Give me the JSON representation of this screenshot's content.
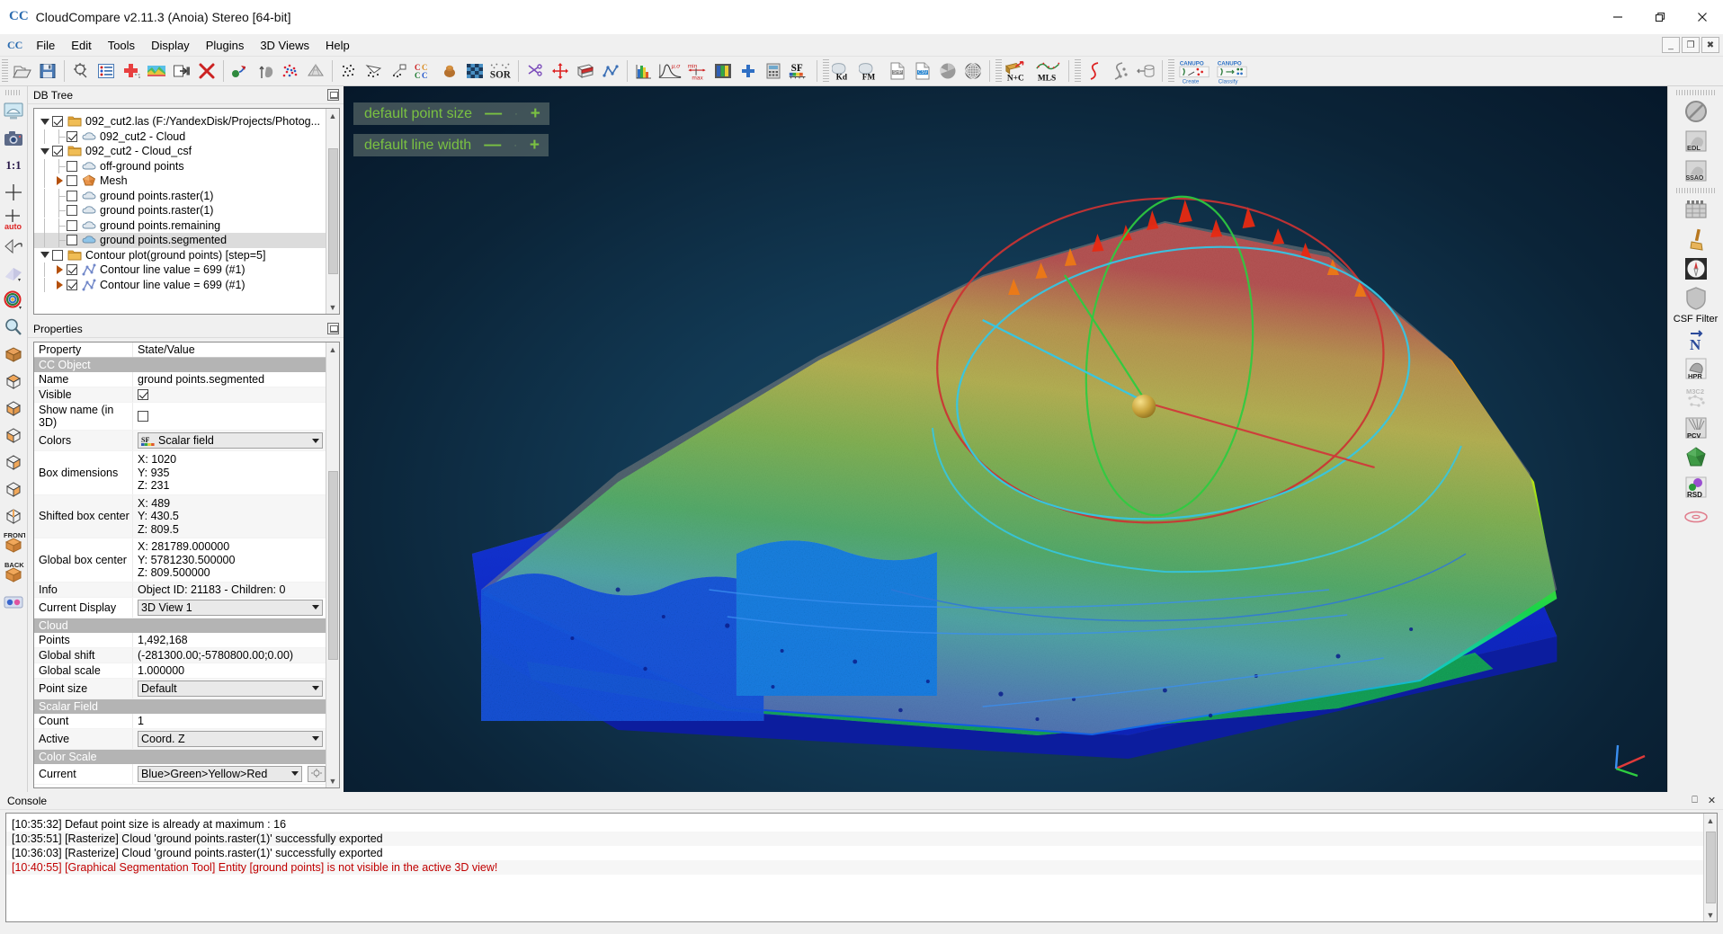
{
  "window": {
    "title": "CloudCompare v2.11.3 (Anoia) Stereo [64-bit]",
    "logo": "CC",
    "minimize": "minimize-icon",
    "maximize": "maximize-icon",
    "close": "close-icon",
    "mdi_restore": "_",
    "mdi_tile": "❐",
    "mdi_close": "✖"
  },
  "menubar": {
    "items": [
      {
        "label": "File"
      },
      {
        "label": "Edit"
      },
      {
        "label": "Tools"
      },
      {
        "label": "Display"
      },
      {
        "label": "Plugins"
      },
      {
        "label": "3D Views"
      },
      {
        "label": "Help"
      }
    ]
  },
  "toolbar": {
    "groups": [
      {
        "buttons": [
          {
            "name": "open-file-icon",
            "tip": "Open"
          },
          {
            "name": "save-file-icon",
            "tip": "Save"
          }
        ]
      },
      {
        "buttons": [
          {
            "name": "global-shift-settings-icon",
            "tip": "Global shift settings"
          },
          {
            "name": "display-properties-icon",
            "tip": "Display settings"
          },
          {
            "name": "add-point-icon",
            "tip": "Add point"
          },
          {
            "name": "colors-icon",
            "tip": "Colors"
          },
          {
            "name": "clone-icon",
            "tip": "Clone"
          },
          {
            "name": "delete-icon",
            "tip": "Delete"
          }
        ]
      },
      {
        "buttons": [
          {
            "name": "merge-icon",
            "tip": "Merge"
          },
          {
            "name": "normals-icon",
            "tip": "Compute normals"
          },
          {
            "name": "subsample-icon",
            "tip": "Subsample"
          },
          {
            "name": "mesh-icon",
            "tip": "Mesh"
          }
        ]
      },
      {
        "buttons": [
          {
            "name": "cloud-cloud-dist-icon",
            "tip": "Cloud/cloud distance"
          },
          {
            "name": "cloud-mesh-dist-icon",
            "tip": "Cloud/mesh distance"
          },
          {
            "name": "cloud-primitive-dist-icon",
            "tip": "Cloud/primitive distance"
          },
          {
            "name": "cc-registration-icon",
            "tip": "Register"
          },
          {
            "name": "match-bb-icon",
            "tip": "Match bounding boxes"
          },
          {
            "name": "statistical-test-icon",
            "tip": "Statistical test"
          },
          {
            "name": "sor-filter-icon",
            "tip": "SOR filter"
          }
        ]
      },
      {
        "buttons": [
          {
            "name": "segment-icon",
            "tip": "Segment"
          },
          {
            "name": "translate-rotate-icon",
            "tip": "Translate/Rotate"
          },
          {
            "name": "cross-section-icon",
            "tip": "Cross section"
          },
          {
            "name": "polyline-icon",
            "tip": "Trace polyline"
          }
        ]
      },
      {
        "buttons": [
          {
            "name": "histogram-icon",
            "tip": "Histogram"
          },
          {
            "name": "gaussian-filter-icon",
            "tip": "Gaussian filter"
          },
          {
            "name": "min-max-icon",
            "tip": "Min/max"
          },
          {
            "name": "color-scale-icon",
            "tip": "Color scale"
          },
          {
            "name": "add-sf-icon",
            "tip": "Add scalar field"
          },
          {
            "name": "sf-calculator-icon",
            "tip": "SF arithmetics"
          },
          {
            "name": "sf-display-icon",
            "tip": "SF display params"
          }
        ]
      },
      {
        "buttons": [
          {
            "name": "kd-tree-icon",
            "tip": "Kd-tree"
          },
          {
            "name": "fast-marching-icon",
            "tip": "Fast marching"
          },
          {
            "name": "shp-export-icon",
            "tip": "Export SHP"
          },
          {
            "name": "csv-export-icon",
            "tip": "Export CSV"
          },
          {
            "name": "fit-plane-icon",
            "tip": "Fit plane"
          },
          {
            "name": "fit-sphere-icon",
            "tip": "Fit sphere"
          }
        ]
      },
      {
        "buttons": [
          {
            "name": "normals-and-curvature-icon",
            "tip": "N+C"
          },
          {
            "name": "mls-smoothing-icon",
            "tip": "MLS"
          }
        ]
      },
      {
        "buttons": [
          {
            "name": "spline-icon",
            "tip": "Spline"
          },
          {
            "name": "section-extract-icon",
            "tip": "Extract sections"
          },
          {
            "name": "unroll-icon",
            "tip": "Unroll"
          }
        ]
      },
      {
        "buttons": [
          {
            "name": "canupo-create-icon",
            "tip": "CANUPO Create"
          },
          {
            "name": "canupo-classify-icon",
            "tip": "CANUPO Classify"
          }
        ]
      }
    ],
    "canupo_create_label": "Create",
    "canupo_classify_label": "Classify",
    "ncs_label": "N+C",
    "mls_label": "MLS",
    "kd_label": "Kd",
    "fm_label": "FM",
    "sor_label": "SOR",
    "sf_label": "SF",
    "canupo_label": "CANUPO"
  },
  "left_toolbar": {
    "buttons": [
      {
        "name": "set-view-to-screen-icon"
      },
      {
        "name": "snapshot-icon"
      },
      {
        "name": "zoom-one-to-one-icon",
        "label": "1:1"
      },
      {
        "name": "pick-rotation-center-icon"
      },
      {
        "name": "auto-pick-rotation-center-icon",
        "label": "auto"
      },
      {
        "name": "toggle-camera-projection-icon"
      },
      {
        "name": "light-settings-icon"
      },
      {
        "name": "color-ramp-icon"
      },
      {
        "name": "zoom-global-icon"
      },
      {
        "name": "bounding-box-icon"
      },
      {
        "name": "view-top-icon"
      },
      {
        "name": "view-bottom-icon"
      },
      {
        "name": "view-left-icon"
      },
      {
        "name": "view-right-icon"
      },
      {
        "name": "view-back-icon"
      },
      {
        "name": "view-iso1-icon"
      },
      {
        "name": "view-front-icon",
        "label": "FRONT"
      },
      {
        "name": "view-rear-icon",
        "label": "BACK"
      },
      {
        "name": "stereo-mode-icon"
      }
    ]
  },
  "right_toolbar": {
    "groups": [
      {
        "buttons": [
          {
            "name": "no-shader-icon",
            "label": ""
          },
          {
            "name": "edl-shader-icon",
            "label": "EDL"
          },
          {
            "name": "ssao-shader-icon",
            "label": "SSAO"
          }
        ]
      },
      {
        "buttons": [
          {
            "name": "animation-plugin-icon",
            "label": ""
          },
          {
            "name": "broom-plugin-icon",
            "label": ""
          },
          {
            "name": "compass-plugin-icon",
            "label": ""
          },
          {
            "name": "csf-filter-plugin-icon",
            "label": "CSF Filter"
          },
          {
            "name": "north-arrow-plugin-icon",
            "label": "N"
          },
          {
            "name": "hpr-plugin-icon",
            "label": "HPR"
          },
          {
            "name": "m3c2-plugin-icon",
            "label": "M3C2"
          },
          {
            "name": "pcv-plugin-icon",
            "label": "PCV"
          },
          {
            "name": "poisson-recon-plugin-icon",
            "label": ""
          },
          {
            "name": "rgb-plugin-icon",
            "label": "RSD"
          },
          {
            "name": "torus-plugin-icon",
            "label": ""
          }
        ]
      }
    ],
    "csf_filter_label": "CSF Filter"
  },
  "db_tree": {
    "title": "DB Tree",
    "items": [
      {
        "indent": 0,
        "expander": "down",
        "checked": true,
        "icon": "folder-icon",
        "label": "092_cut2.las (F:/YandexDisk/Projects/Photog...",
        "selected": false
      },
      {
        "indent": 1,
        "expander": "none",
        "checked": true,
        "icon": "cloud-icon",
        "label": "092_cut2 - Cloud",
        "selected": false
      },
      {
        "indent": 0,
        "expander": "down",
        "checked": true,
        "icon": "folder-icon",
        "label": "092_cut2 - Cloud_csf",
        "selected": false
      },
      {
        "indent": 1,
        "expander": "none",
        "checked": false,
        "icon": "cloud-icon",
        "label": "off-ground points",
        "selected": false
      },
      {
        "indent": 1,
        "expander": "right",
        "checked": false,
        "icon": "mesh-icon",
        "label": "Mesh",
        "selected": false
      },
      {
        "indent": 1,
        "expander": "none",
        "checked": false,
        "icon": "cloud-icon",
        "label": "ground points.raster(1)",
        "selected": false
      },
      {
        "indent": 1,
        "expander": "none",
        "checked": false,
        "icon": "cloud-icon",
        "label": "ground points.raster(1)",
        "selected": false
      },
      {
        "indent": 1,
        "expander": "none",
        "checked": false,
        "icon": "cloud-icon",
        "label": "ground points.remaining",
        "selected": false
      },
      {
        "indent": 1,
        "expander": "none",
        "checked": false,
        "icon": "cloud-icon",
        "label": "ground points.segmented",
        "selected": true
      },
      {
        "indent": 0,
        "expander": "down",
        "checked": false,
        "icon": "folder-icon",
        "label": "Contour plot(ground points) [step=5]",
        "selected": false
      },
      {
        "indent": 1,
        "expander": "right",
        "checked": true,
        "icon": "polyline-icon",
        "label": "Contour line value = 699 (#1)",
        "selected": false
      },
      {
        "indent": 1,
        "expander": "right",
        "checked": true,
        "icon": "polyline-icon",
        "label": "Contour line value = 699 (#1)",
        "selected": false
      }
    ]
  },
  "properties": {
    "title": "Properties",
    "header": {
      "key": "Property",
      "value": "State/Value"
    },
    "rows": [
      {
        "type": "section",
        "label": "CC Object"
      },
      {
        "type": "text",
        "key": "Name",
        "value": "ground points.segmented"
      },
      {
        "type": "check",
        "key": "Visible",
        "checked": true
      },
      {
        "type": "check",
        "key": "Show name (in 3D)",
        "checked": false
      },
      {
        "type": "combo-sf",
        "key": "Colors",
        "value": "Scalar field"
      },
      {
        "type": "multi",
        "key": "Box dimensions",
        "lines": [
          "X: 1020",
          "Y: 935",
          "Z: 231"
        ]
      },
      {
        "type": "multi",
        "key": "Shifted box center",
        "lines": [
          "X: 489",
          "Y: 430.5",
          "Z: 809.5"
        ]
      },
      {
        "type": "multi",
        "key": "Global box center",
        "lines": [
          "X: 281789.000000",
          "Y: 5781230.500000",
          "Z: 809.500000"
        ]
      },
      {
        "type": "text",
        "key": "Info",
        "value": "Object ID: 21183 - Children: 0"
      },
      {
        "type": "combo",
        "key": "Current Display",
        "value": "3D View 1"
      },
      {
        "type": "section",
        "label": "Cloud"
      },
      {
        "type": "text",
        "key": "Points",
        "value": "1,492,168"
      },
      {
        "type": "text",
        "key": "Global shift",
        "value": "(-281300.00;-5780800.00;0.00)"
      },
      {
        "type": "text",
        "key": "Global scale",
        "value": "1.000000"
      },
      {
        "type": "combo",
        "key": "Point size",
        "value": "Default"
      },
      {
        "type": "section",
        "label": "Scalar Field"
      },
      {
        "type": "text",
        "key": "Count",
        "value": "1"
      },
      {
        "type": "combo",
        "key": "Active",
        "value": "Coord. Z"
      },
      {
        "type": "section",
        "label": "Color Scale"
      },
      {
        "type": "combo-btn",
        "key": "Current",
        "value": "Blue>Green>Yellow>Red"
      }
    ]
  },
  "viewport": {
    "overlays": [
      {
        "label": "default point size",
        "minus": "—",
        "plus": "+",
        "name": "default-point-size-overlay"
      },
      {
        "label": "default line width",
        "minus": "—",
        "plus": "+",
        "name": "default-line-width-overlay"
      }
    ],
    "axis_gizmo": "axis-gizmo-icon"
  },
  "console": {
    "title": "Console",
    "lines": [
      {
        "text": "[10:35:32] Defaut point size is already at maximum : 16",
        "error": false
      },
      {
        "text": "[10:35:51] [Rasterize] Cloud 'ground points.raster(1)' successfully exported",
        "error": false
      },
      {
        "text": "[10:36:03] [Rasterize] Cloud 'ground points.raster(1)' successfully exported",
        "error": false
      },
      {
        "text": "[10:40:55] [Graphical Segmentation Tool] Entity [ground points] is not visible in the active 3D view!",
        "error": true
      }
    ]
  },
  "colors": {
    "accent": "#2b6cb0",
    "overlay_green": "#7ac142",
    "error_red": "#c00000",
    "section_gray": "#b4b4b4",
    "selection_gray": "#dcdcdc",
    "viewport_bg": "#123a55"
  }
}
